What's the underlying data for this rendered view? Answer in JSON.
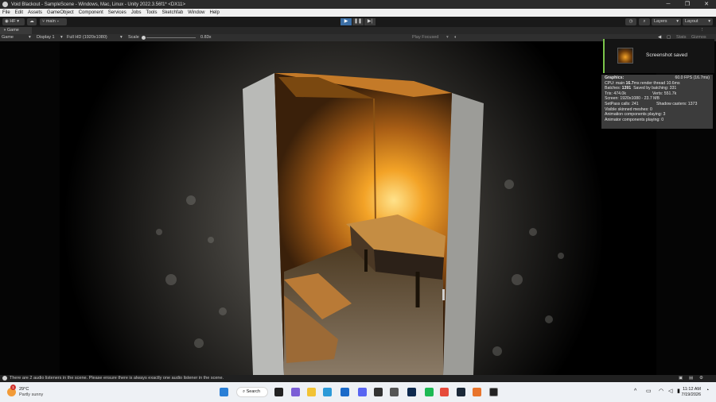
{
  "window": {
    "title": "Void Blackout - SampleScene - Windows, Mac, Linux - Unity 2022.3.56f1* <DX11>",
    "minimize": "─",
    "maximize": "❐",
    "close": "✕"
  },
  "menu": [
    "File",
    "Edit",
    "Assets",
    "GameObject",
    "Component",
    "Services",
    "Jobs",
    "Tools",
    "Sketchfab",
    "Window",
    "Help"
  ],
  "toolbar": {
    "account": "HF",
    "branch": "main",
    "layers": "Layers",
    "layout": "Layout"
  },
  "game_tab": {
    "label": "Game"
  },
  "game_toolbar": {
    "view_mode": "Game",
    "display": "Display 1",
    "resolution": "Full HD (1920x1080)",
    "scale_label": "Scale",
    "scale_value": "0.83x",
    "play_focused": "Play Focused",
    "stats": "Stats",
    "gizmos": "Gizmos"
  },
  "toast": {
    "message": "Screenshot saved"
  },
  "stats": {
    "heading": "Graphics:",
    "fps": "60.0 FPS (16.7ms)",
    "cpu_main_prefix": "CPU: main ",
    "cpu_main": "16.7",
    "cpu_render": "ms  render thread 10.6ms",
    "batches_prefix": "Batches: ",
    "batches": "1391",
    "saved_by_batching": "Saved by batching: 331",
    "tris": "Tris: 474.0k",
    "verts": "Verts: 551.7k",
    "screen": "Screen: 1920x1080 - 23.7 MB",
    "setpass": "SetPass calls: 241",
    "shadow_casters": "Shadow casters: 1373",
    "visible_skinned": "Visible skinned meshes: 0",
    "anim_components": "Animation components playing: 3",
    "animator_components": "Animator components playing: 0"
  },
  "console": {
    "message": "There are 2 audio listeners in the scene. Please ensure there is always exactly one audio listener in the scene."
  },
  "taskbar": {
    "weather_temp": "29°C",
    "weather_desc": "Partly sunny",
    "search": "Search",
    "time": "11:12 AM",
    "date": "7/19/2026",
    "weather_badge": "1"
  },
  "colors": {
    "titlebar": "#2b2b2b",
    "play_active": "#3b6ea5",
    "toast_accent": "#7bc44a",
    "warm_light": "#f3a327"
  }
}
